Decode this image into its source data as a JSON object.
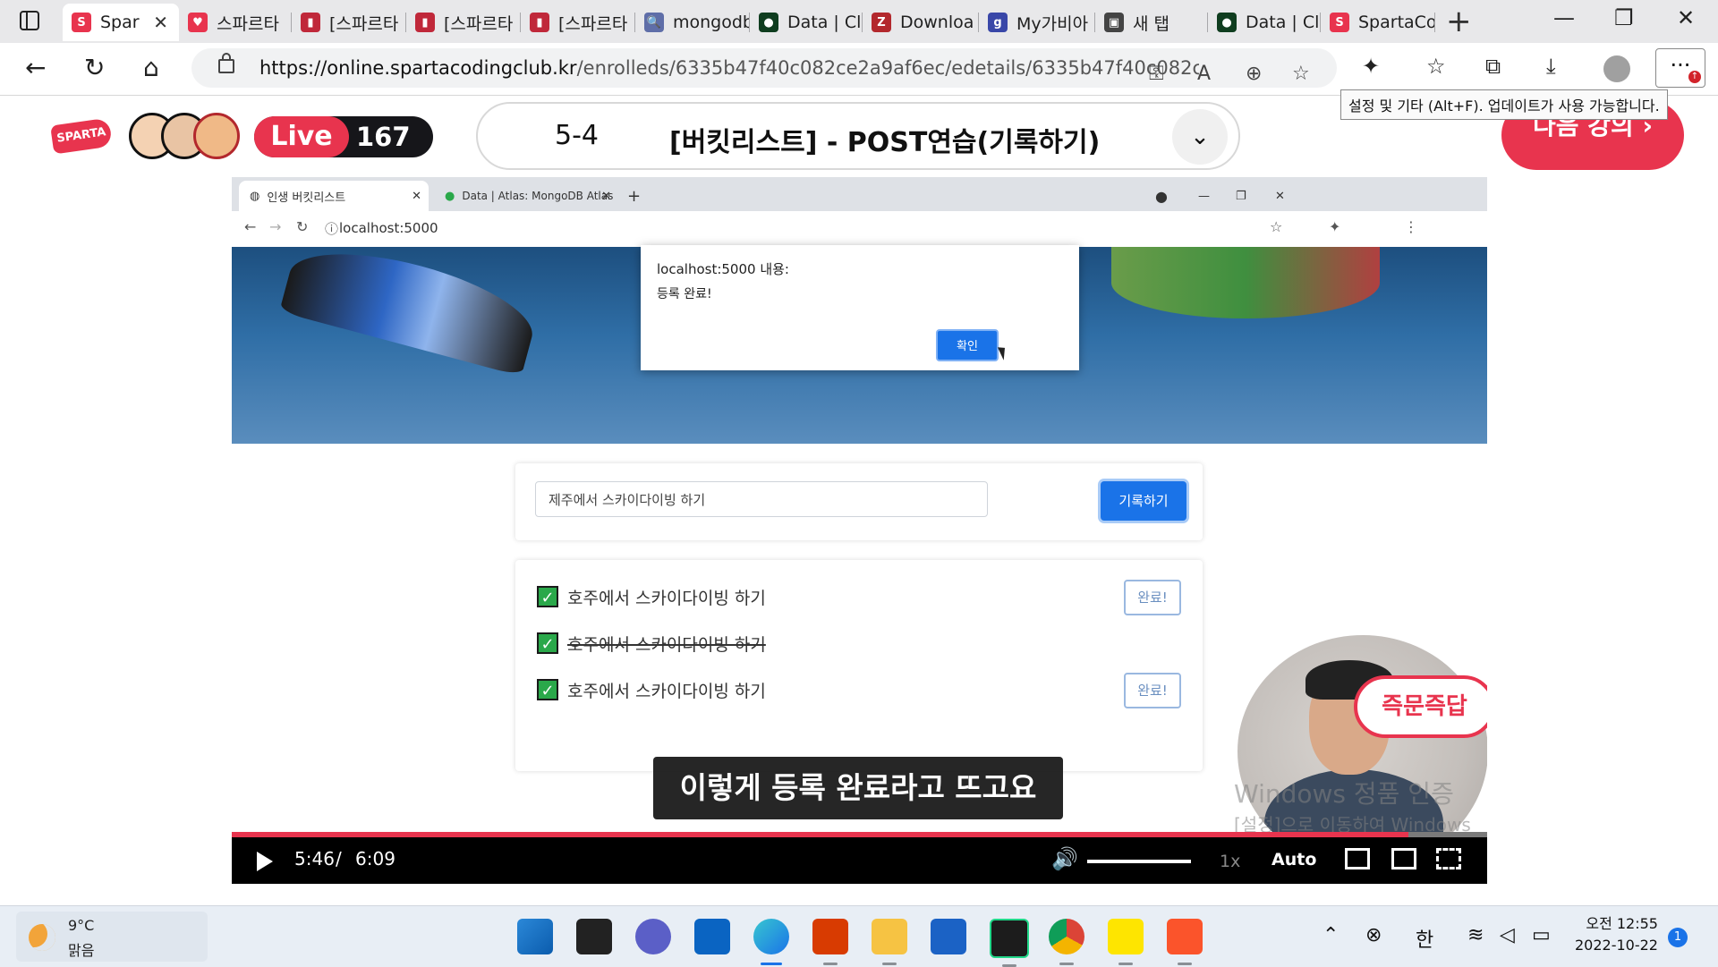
{
  "browser": {
    "tabs": [
      {
        "label": "Spar",
        "color": "#e8344e",
        "glyph": "S"
      },
      {
        "label": "스파르타",
        "color": "#e8344e",
        "glyph": "♥"
      },
      {
        "label": "[스파르타",
        "color": "#c0283a",
        "glyph": "▮"
      },
      {
        "label": "[스파르타",
        "color": "#c0283a",
        "glyph": "▮"
      },
      {
        "label": "[스파르타",
        "color": "#c0283a",
        "glyph": "▮"
      },
      {
        "label": "mongodb",
        "color": "#5f6ea8",
        "glyph": "🔍"
      },
      {
        "label": "Data | Cl",
        "color": "#0f3d1f",
        "glyph": "●"
      },
      {
        "label": "Downloa",
        "color": "#b3282d",
        "glyph": "Z"
      },
      {
        "label": "My가비아",
        "color": "#3947a8",
        "glyph": "g"
      },
      {
        "label": "새 탭",
        "color": "#444444",
        "glyph": "▣"
      },
      {
        "label": "Data | Cl",
        "color": "#0f3d1f",
        "glyph": "●"
      },
      {
        "label": "SpartaCo",
        "color": "#e8344e",
        "glyph": "S"
      }
    ],
    "url_host": "https://online.spartacodingclub.kr",
    "url_path": "/enrolleds/6335b47f40c082ce2a9af6ec/edetails/6335b47f40c082ce2a...",
    "tooltip": "설정 및 기타 (Alt+F). 업데이트가 사용 가능합니다."
  },
  "header": {
    "logo": "SPARTA",
    "live_label": "Live",
    "viewer_count": "167",
    "lesson_number": "5-4",
    "lesson_title": "[버킷리스트] - POST연습(기록하기)",
    "next_label": "다음 강의 ›"
  },
  "video": {
    "inner_tabs": [
      "인생 버킷리스트",
      "Data | Atlas: MongoDB Atlas"
    ],
    "inner_url": "localhost:5000",
    "dialog_header": "localhost:5000 내용:",
    "dialog_message": "등록 완료!",
    "dialog_ok": "확인",
    "input_value": "제주에서 스카이다이빙 하기",
    "record_button": "기록하기",
    "items": [
      {
        "text": "호주에서 스카이다이빙 하기",
        "done": false,
        "button": "완료!"
      },
      {
        "text": "호주에서 스카이다이빙 하기",
        "done": true,
        "button": ""
      },
      {
        "text": "호주에서 스카이다이빙 하기",
        "done": false,
        "button": "완료!"
      }
    ],
    "caption": "이렇게 등록 완료라고 뜨고요",
    "qa_badge": "즉문즉답",
    "watermark_title": "Windows 정품 인증",
    "watermark_sub": "[설정]으로 이동하여 Windows를 정품 인증합니다.",
    "current_time": "5:46",
    "time_separator": "/",
    "duration": "6:09",
    "progress_fraction": 0.937,
    "speed": "1x",
    "quality": "Auto"
  },
  "taskbar": {
    "temperature": "9°C",
    "condition": "맑음",
    "ime": "한",
    "time": "오전 12:55",
    "date": "2022-10-22",
    "notifications": "1"
  },
  "colors": {
    "accent": "#e8344e",
    "link": "#1a73e8"
  }
}
